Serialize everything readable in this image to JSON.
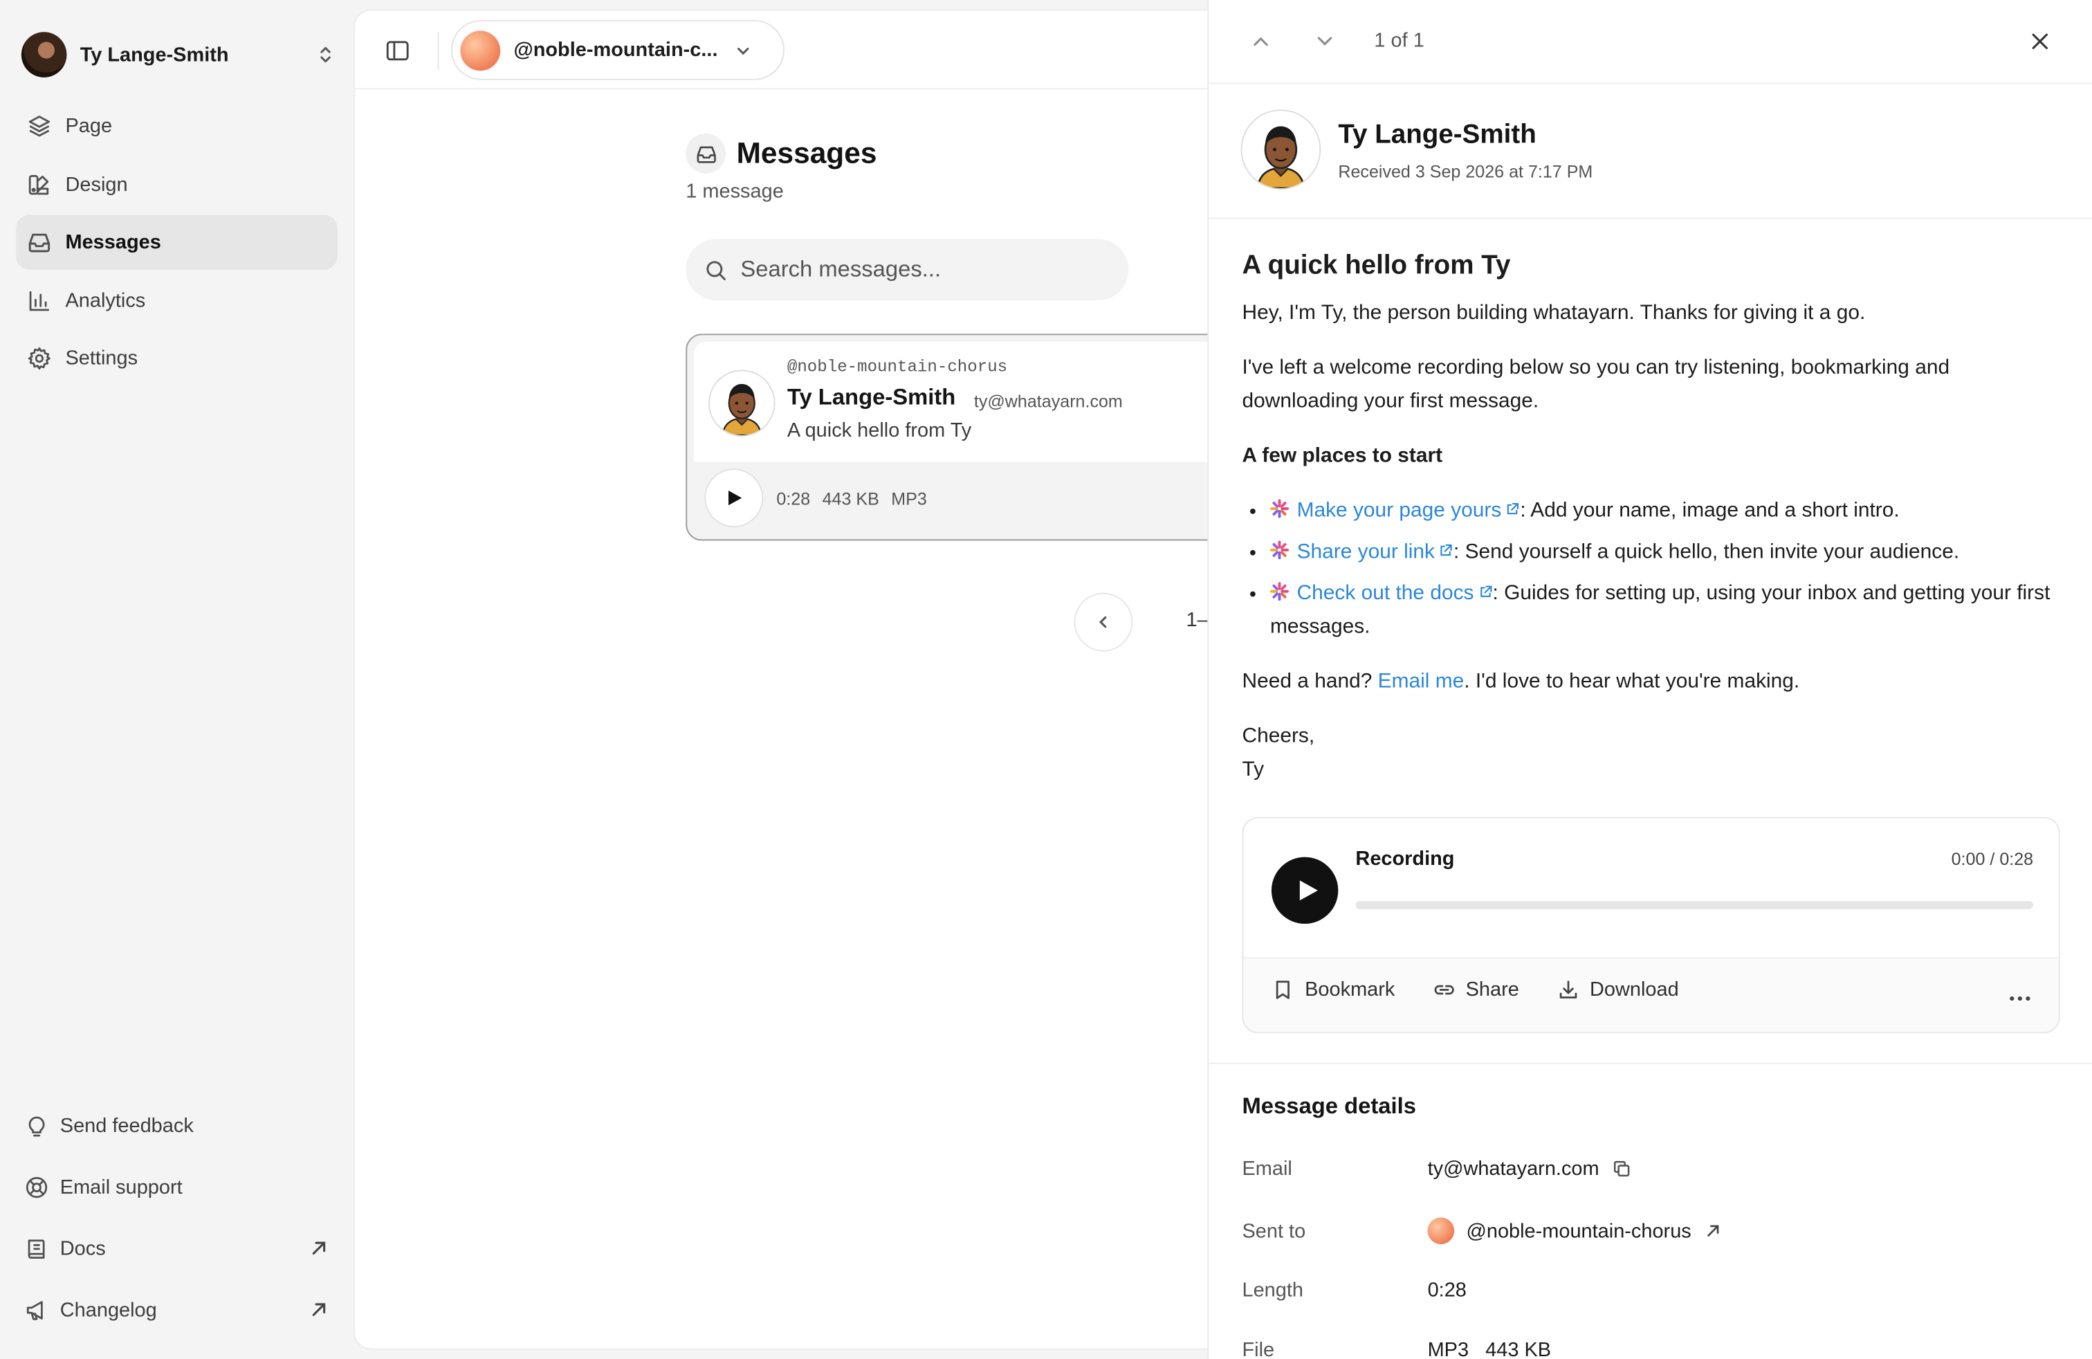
{
  "sidebar": {
    "user_name": "Ty Lange-Smith",
    "nav": [
      {
        "label": "Page",
        "icon": "layers-icon"
      },
      {
        "label": "Design",
        "icon": "palette-icon"
      },
      {
        "label": "Messages",
        "icon": "inbox-icon",
        "active": true
      },
      {
        "label": "Analytics",
        "icon": "bar-chart-icon"
      },
      {
        "label": "Settings",
        "icon": "gear-icon"
      }
    ],
    "bottom": [
      {
        "label": "Send feedback",
        "icon": "lightbulb-icon"
      },
      {
        "label": "Email support",
        "icon": "lifebuoy-icon"
      },
      {
        "label": "Docs",
        "icon": "book-icon",
        "external": true
      },
      {
        "label": "Changelog",
        "icon": "megaphone-icon",
        "external": true
      }
    ]
  },
  "topbar": {
    "profile_handle": "@noble-mountain-c..."
  },
  "messages": {
    "title": "Messages",
    "count": "1 message",
    "search_placeholder": "Search messages...",
    "card": {
      "handle": "@noble-mountain-chorus",
      "name": "Ty Lange-Smith",
      "email": "ty@whatayarn.com",
      "subject": "A quick hello from Ty",
      "duration": "0:28",
      "size": "443 KB",
      "format": "MP3"
    },
    "pager_range": "1–"
  },
  "panel": {
    "position": "1 of 1",
    "sender_name": "Ty Lange-Smith",
    "received": "Received 3 Sep 2026 at 7:17 PM",
    "subject": "A quick hello from Ty",
    "para1": "Hey, I'm Ty, the person building whatayarn. Thanks for giving it a go.",
    "para2": "I've left a welcome recording below so you can try listening, bookmarking and downloading your first message.",
    "places_heading": "A few places to start",
    "places": [
      {
        "link": "Make your page yours",
        "text": ": Add your name, image and a short intro."
      },
      {
        "link": "Share your link",
        "text": ": Send yourself a quick hello, then invite your audience."
      },
      {
        "link": "Check out the docs",
        "text": ": Guides for setting up, using your inbox and getting your first messages."
      }
    ],
    "hand_prefix": "Need a hand? ",
    "hand_link": "Email me",
    "hand_suffix": ". I'd love to hear what you're making.",
    "signoff": "Cheers,",
    "signature": "Ty",
    "player": {
      "label": "Recording",
      "current": "0:00",
      "total": "0:28",
      "progress": 0,
      "bookmark_label": "Bookmark",
      "share_label": "Share",
      "download_label": "Download"
    },
    "details": {
      "title": "Message details",
      "rows": [
        {
          "label": "Email",
          "value": "ty@whatayarn.com"
        },
        {
          "label": "Sent to",
          "value": "@noble-mountain-chorus"
        },
        {
          "label": "Length",
          "value": "0:28"
        },
        {
          "label": "File",
          "value": "MP3   443 KB"
        }
      ]
    }
  },
  "colors": {
    "accent_link": "#2b87d9",
    "active_nav_bg": "#e6e6e6",
    "sidebar_bg": "#f4f4f4"
  }
}
